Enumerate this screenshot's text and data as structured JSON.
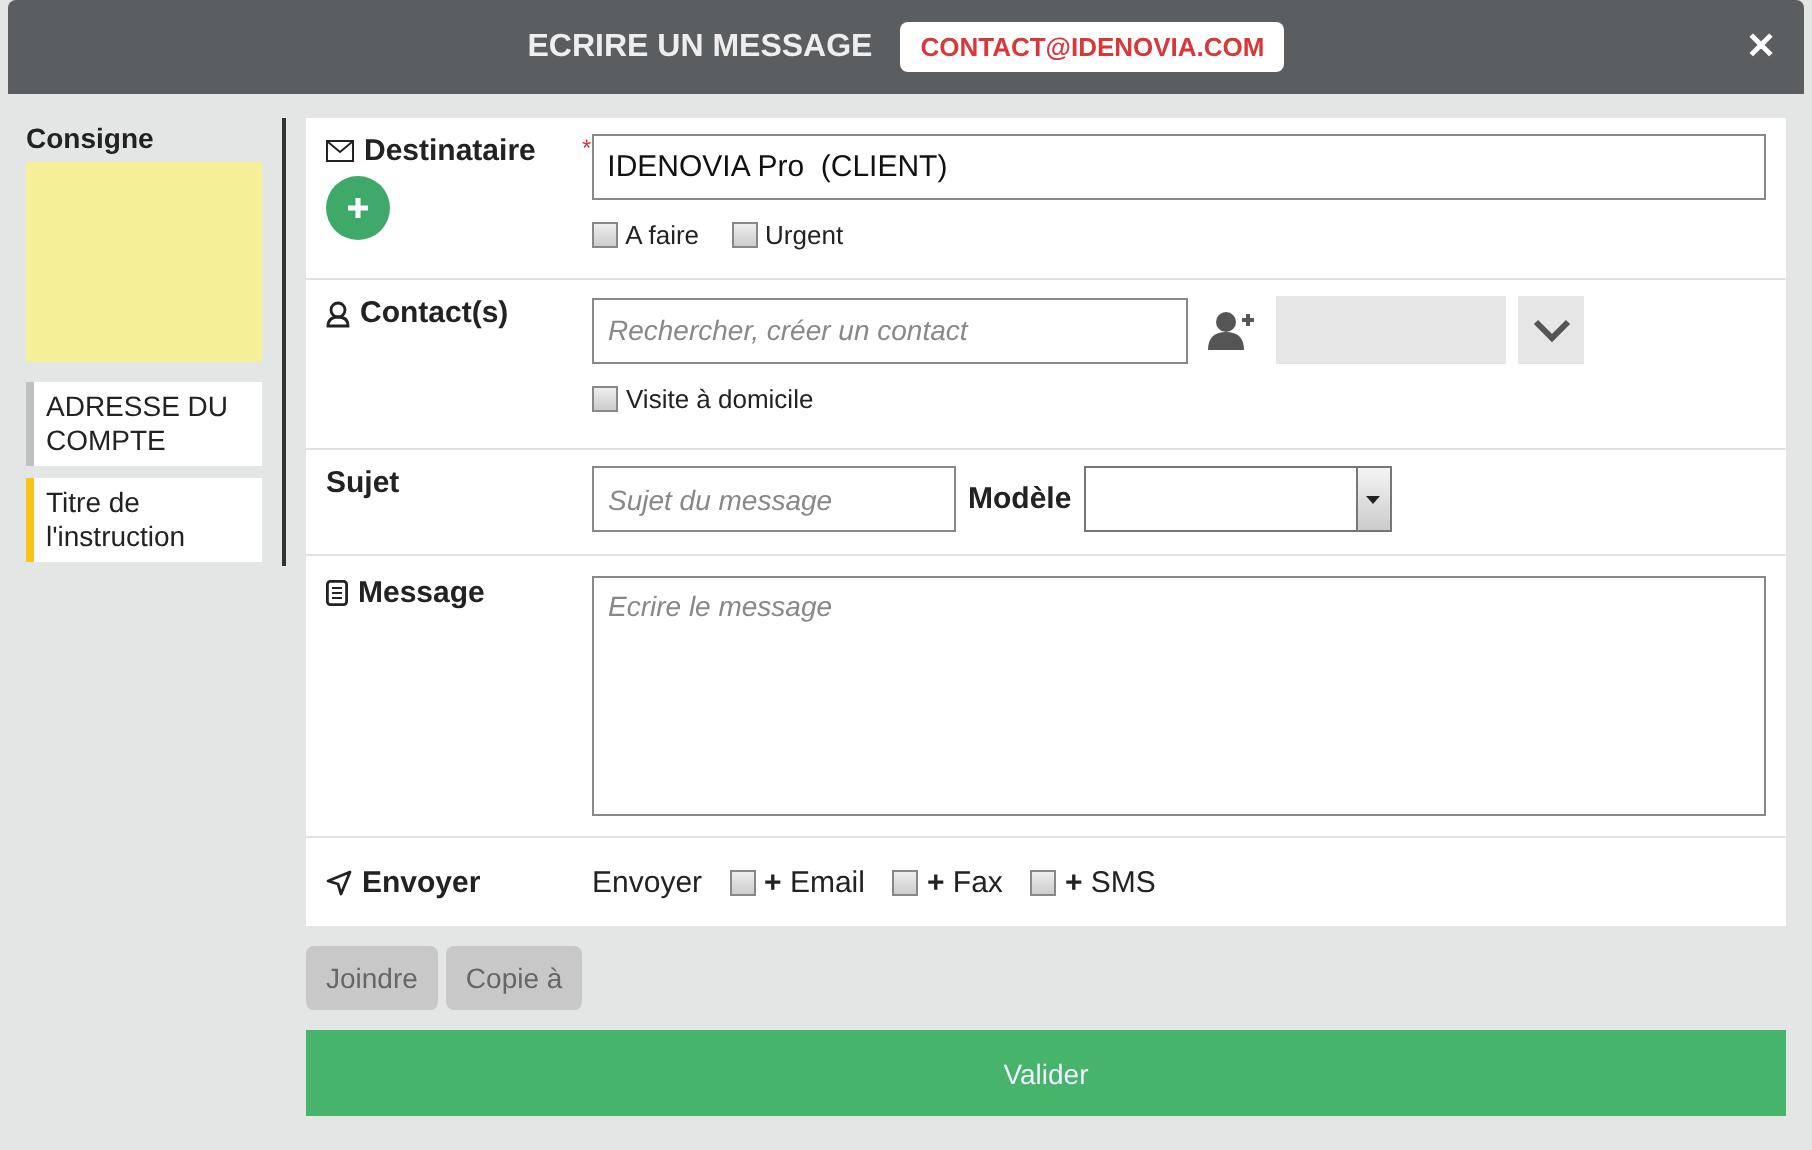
{
  "window": {
    "title": "ECRIRE UN MESSAGE",
    "email_badge": "CONTACT@IDENOVIA.COM",
    "close": "✕"
  },
  "sidebar": {
    "title": "Consigne",
    "items": [
      {
        "label": "ADRESSE DU COMPTE",
        "color": "#c0c0c0"
      },
      {
        "label": "Titre de l'instruction",
        "color": "#f5c518"
      }
    ]
  },
  "recipient": {
    "label": "Destinataire",
    "required_mark": "*",
    "value": "IDENOVIA Pro  (CLIENT)",
    "checkboxes": [
      {
        "label": "A faire",
        "checked": false
      },
      {
        "label": "Urgent",
        "checked": false
      }
    ]
  },
  "contact": {
    "label": "Contact(s)",
    "placeholder": "Rechercher, créer un contact",
    "checkboxes": [
      {
        "label": "Visite à domicile",
        "checked": false
      }
    ]
  },
  "subject": {
    "label": "Sujet",
    "placeholder": "Sujet du message",
    "template_label": "Modèle"
  },
  "message": {
    "label": "Message",
    "placeholder": "Ecrire le message"
  },
  "send": {
    "label": "Envoyer",
    "prefix": "Envoyer",
    "options": [
      {
        "label": "**+** Email",
        "checked": false
      },
      {
        "label": "**+** Fax",
        "checked": false
      },
      {
        "label": "**+** SMS",
        "checked": false
      }
    ]
  },
  "buttons": [
    "Joindre",
    "Copie à"
  ],
  "submit": "Valider"
}
